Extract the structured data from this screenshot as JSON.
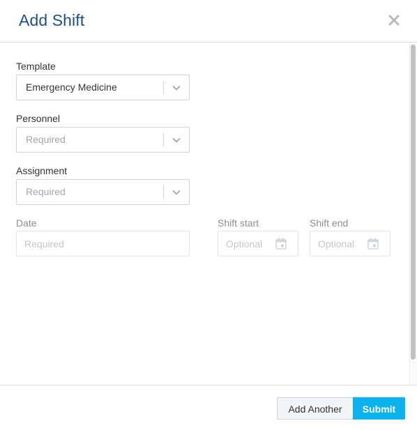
{
  "header": {
    "title": "Add Shift"
  },
  "form": {
    "template": {
      "label": "Template",
      "value": "Emergency Medicine"
    },
    "personnel": {
      "label": "Personnel",
      "placeholder": "Required"
    },
    "assignment": {
      "label": "Assignment",
      "placeholder": "Required"
    },
    "date": {
      "label": "Date",
      "placeholder": "Required"
    },
    "shift_start": {
      "label": "Shift start",
      "placeholder": "Optional"
    },
    "shift_end": {
      "label": "Shift end",
      "placeholder": "Optional"
    }
  },
  "footer": {
    "add_another_label": "Add Another",
    "submit_label": "Submit"
  },
  "colors": {
    "title": "#1d4f8c",
    "primary_button": "#0bb2ef"
  },
  "icons": [
    "close-icon",
    "chevron-down-icon",
    "calendar-icon"
  ]
}
